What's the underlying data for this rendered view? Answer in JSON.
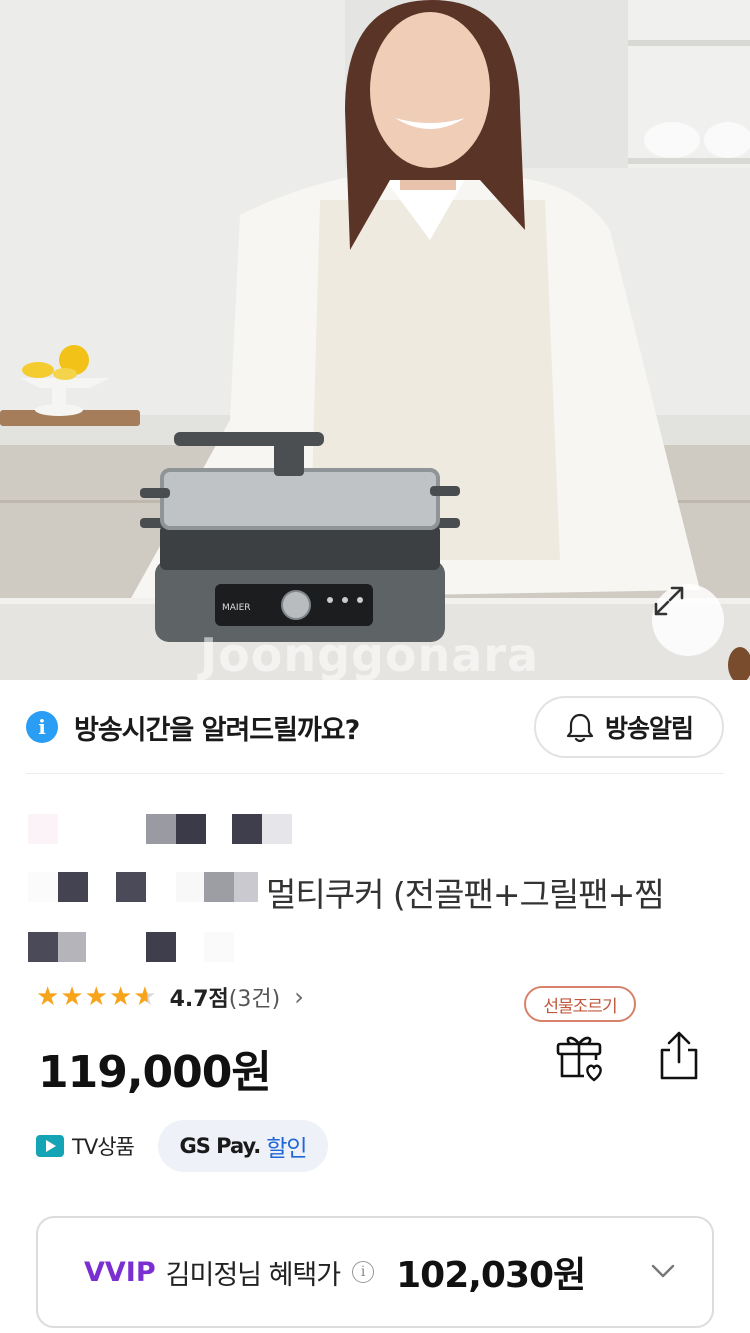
{
  "hero": {
    "watermark": "Joonggonara",
    "expand_icon": "expand-arrows-icon"
  },
  "broadcast": {
    "question": "방송시간을 알려드릴까요?",
    "button_label": "방송알림",
    "info_icon_glyph": "i",
    "bell_icon": "bell-icon"
  },
  "product": {
    "title_visible": "멀티쿠커 (전골팬+그릴팬+찜",
    "rating": {
      "stars_value": 4.7,
      "score_text": "4.7점",
      "count_text": "(3건)",
      "chevron": "›"
    },
    "price": "119,000원",
    "gift_label": "선물조르기",
    "gift_icon": "gift-heart-icon",
    "share_icon": "share-icon"
  },
  "tags": {
    "tv_label": "TV상품",
    "gs_brand": "GS Pay.",
    "gs_discount": "할인"
  },
  "vvip": {
    "tier": "VVIP",
    "member_text": "김미정님 혜택가",
    "info_glyph": "i",
    "price": "102,030원"
  },
  "colors": {
    "accent_blue": "#2a9df4",
    "star": "#f6a41c",
    "vvip_purple": "#7b2fd1",
    "gift_red": "#c0583d",
    "gs_blue": "#1f66d6",
    "tv_teal": "#15a3b6"
  }
}
